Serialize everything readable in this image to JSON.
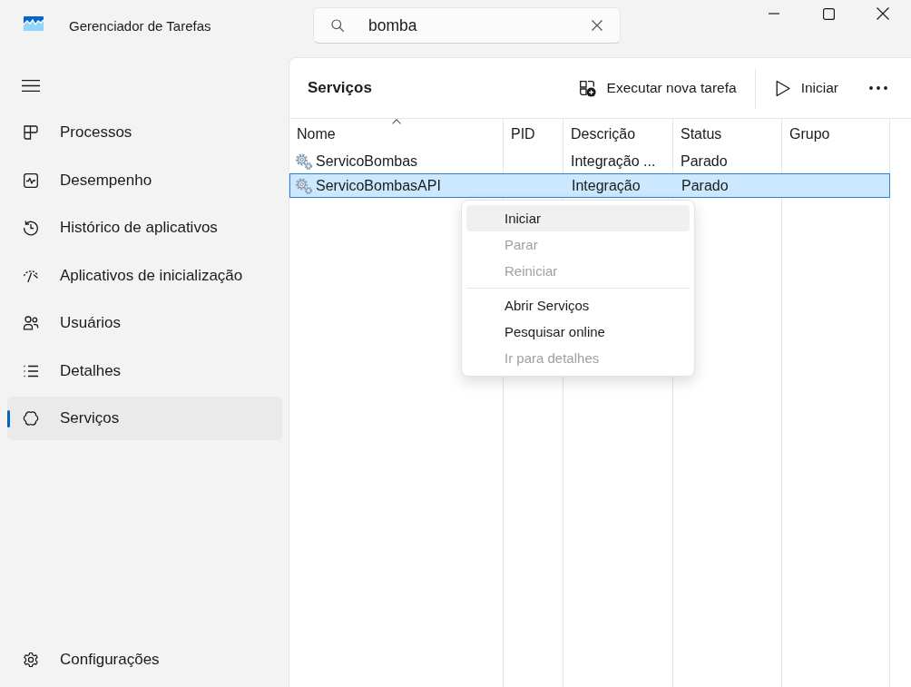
{
  "window": {
    "title": "Gerenciador de Tarefas"
  },
  "search": {
    "value": "bomba"
  },
  "sidebar": {
    "items": [
      {
        "kind": "processes",
        "label": "Processos",
        "selected": false
      },
      {
        "kind": "performance",
        "label": "Desempenho",
        "selected": false
      },
      {
        "kind": "history",
        "label": "Histórico de aplicativos",
        "selected": false
      },
      {
        "kind": "startup",
        "label": "Aplicativos de inicialização",
        "selected": false
      },
      {
        "kind": "users",
        "label": "Usuários",
        "selected": false
      },
      {
        "kind": "details",
        "label": "Detalhes",
        "selected": false
      },
      {
        "kind": "services",
        "label": "Serviços",
        "selected": true
      }
    ],
    "settings": {
      "label": "Configurações"
    }
  },
  "page": {
    "title": "Serviços",
    "toolbar": [
      {
        "kind": "run-task",
        "label": "Executar nova tarefa"
      },
      {
        "kind": "start",
        "label": "Iniciar"
      },
      {
        "kind": "more"
      }
    ]
  },
  "table": {
    "columns": [
      {
        "label": "Nome",
        "sorted": true
      },
      {
        "label": "PID",
        "sorted": false
      },
      {
        "label": "Descrição",
        "sorted": false
      },
      {
        "label": "Status",
        "sorted": false
      },
      {
        "label": "Grupo",
        "sorted": false
      }
    ],
    "rows": [
      {
        "name": "ServicoBombas",
        "description": "Integração ...",
        "status": "Parado",
        "selected": false
      },
      {
        "name": "ServicoBombasAPI",
        "description": "Integração",
        "status": "Parado",
        "selected": true
      }
    ]
  },
  "context_menu": {
    "groups": [
      {
        "items": [
          {
            "label": "Iniciar",
            "highlighted": true,
            "disabled": false
          },
          {
            "label": "Parar",
            "highlighted": false,
            "disabled": true
          },
          {
            "label": "Reiniciar",
            "highlighted": false,
            "disabled": true
          }
        ]
      },
      {
        "items": [
          {
            "label": "Abrir Serviços",
            "highlighted": false,
            "disabled": false
          },
          {
            "label": "Pesquisar online",
            "highlighted": false,
            "disabled": false
          },
          {
            "label": "Ir para detalhes",
            "highlighted": false,
            "disabled": true
          }
        ]
      }
    ]
  }
}
